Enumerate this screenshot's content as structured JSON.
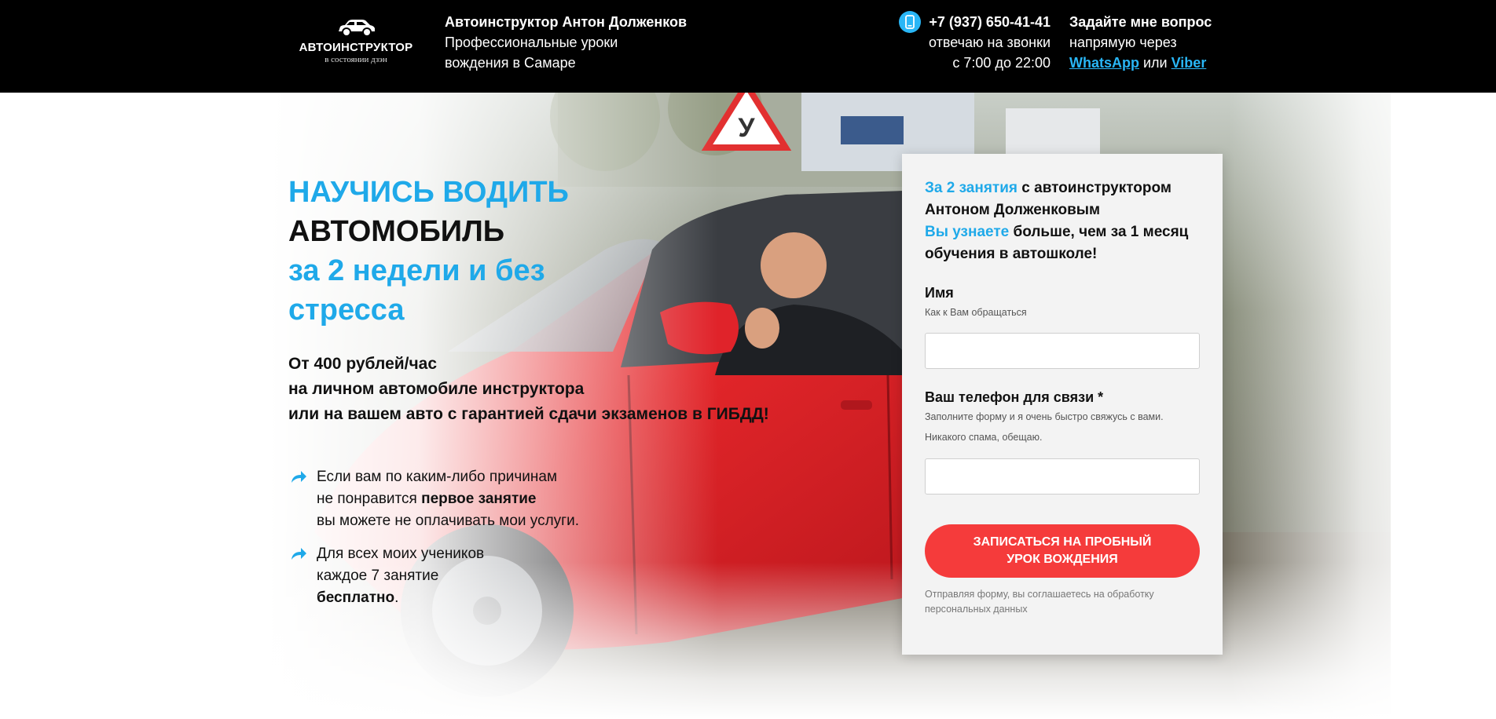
{
  "header": {
    "logo": {
      "title": "АВТОИНСТРУКТОР",
      "subtitle": "в состоянии дзэн",
      "icon": "car-icon"
    },
    "about": {
      "name": "Автоинструктор Антон Долженков",
      "line2": "Профессиональные уроки",
      "line3": "вождения в Самаре"
    },
    "phone": {
      "icon": "phone-icon",
      "number": "+7 (937) 650-41-41",
      "line2": "отвечаю на звонки",
      "line3": "с 7:00 до 22:00"
    },
    "ask": {
      "line1": "Задайте мне вопрос",
      "line2": "напрямую через",
      "whatsapp": "WhatsApp",
      "or": " или ",
      "viber": "Viber"
    }
  },
  "hero": {
    "headline": {
      "line1": "НАУЧИСЬ ВОДИТЬ",
      "line2": "АВТОМОБИЛЬ",
      "line3": "за 2 недели и без",
      "line4": "стресса"
    },
    "sub": {
      "line1": "От 400 рублей/час",
      "line2": "на личном автомобиле инструктора",
      "line3": "или на вашем авто с гарантией сдачи экзаменов в ГИБДД!"
    },
    "sign_letter": "У",
    "bullets": [
      {
        "icon": "curved-arrow-icon",
        "line1": "Если вам по каким-либо причинам",
        "line2_pre": "не понравится ",
        "line2_bold": "первое занятие",
        "line3": "вы можете не оплачивать мои услуги."
      },
      {
        "icon": "curved-arrow-icon",
        "line1": "Для всех моих учеников",
        "line2": "каждое 7 занятие",
        "line3_bold": "бесплатно",
        "line3_post": "."
      }
    ]
  },
  "form": {
    "intro": {
      "p1_blue": "За 2 занятия",
      "p1_rest": " с автоинструктором",
      "p2": "Антоном Долженковым",
      "p3_blue": "Вы узнаете",
      "p3_rest": " больше, чем за 1 месяц",
      "p4": "обучения в автошколе!"
    },
    "name_label": "Имя",
    "name_hint": "Как к Вам обращаться",
    "name_value": "",
    "phone_label": "Ваш телефон для связи *",
    "phone_hint1": "Заполните форму и я очень быстро свяжусь с вами.",
    "phone_hint2": "Никакого спама, обещаю.",
    "phone_value": "",
    "submit_label": "ЗАПИСАТЬСЯ НА ПРОБНЫЙ УРОК ВОЖДЕНИЯ",
    "agree": "Отправляя форму, вы соглашаетесь на обработку персональных данных"
  },
  "colors": {
    "accent_blue": "#1fa9e9",
    "cta_red": "#f53b3b",
    "header_bg": "#000000",
    "car_red": "#e8292b"
  }
}
